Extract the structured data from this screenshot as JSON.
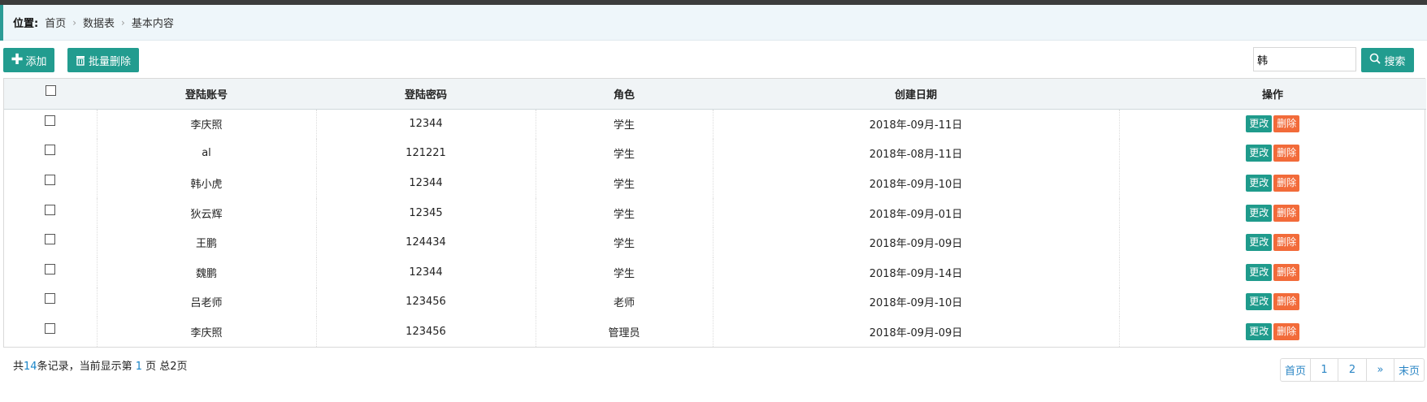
{
  "breadcrumb": {
    "label": "位置:",
    "items": [
      "首页",
      "数据表",
      "基本内容"
    ]
  },
  "toolbar": {
    "add_label": "添加",
    "batch_delete_label": "批量删除",
    "search_value": "韩",
    "search_label": "搜索"
  },
  "table": {
    "headers": [
      "登陆账号",
      "登陆密码",
      "角色",
      "创建日期",
      "操作"
    ],
    "rows": [
      {
        "account": "李庆照",
        "password": "12344",
        "role": "学生",
        "date": "2018年-09月-11日"
      },
      {
        "account": "al",
        "password": "121221",
        "role": "学生",
        "date": "2018年-08月-11日"
      },
      {
        "account": "韩小虎",
        "password": "12344",
        "role": "学生",
        "date": "2018年-09月-10日"
      },
      {
        "account": "狄云辉",
        "password": "12345",
        "role": "学生",
        "date": "2018年-09月-01日"
      },
      {
        "account": "王鹏",
        "password": "124434",
        "role": "学生",
        "date": "2018年-09月-09日"
      },
      {
        "account": "魏鹏",
        "password": "12344",
        "role": "学生",
        "date": "2018年-09月-14日"
      },
      {
        "account": "吕老师",
        "password": "123456",
        "role": "老师",
        "date": "2018年-09月-10日"
      },
      {
        "account": "李庆照",
        "password": "123456",
        "role": "管理员",
        "date": "2018年-09月-09日"
      }
    ],
    "edit_label": "更改",
    "delete_label": "删除"
  },
  "footer": {
    "prefix": "共",
    "total": "14",
    "mid": "条记录，当前显示第 ",
    "current": "1",
    "suffix1": " 页 总",
    "pages": "2",
    "suffix2": "页"
  },
  "pager": {
    "first": "首页",
    "p1": "1",
    "p2": "2",
    "next": "»",
    "last": "末页"
  },
  "colors": {
    "primary": "#229c8f",
    "danger": "#f26b3a",
    "link": "#2b86c5"
  }
}
